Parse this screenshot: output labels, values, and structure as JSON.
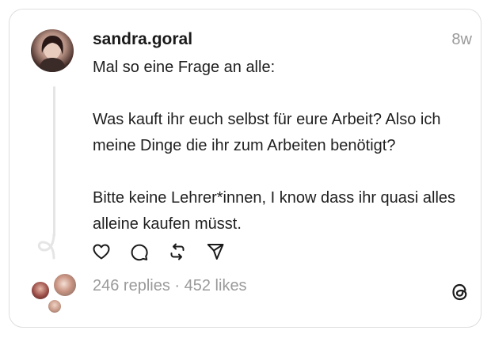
{
  "post": {
    "author": "sandra.goral",
    "timestamp": "8w",
    "paragraphs": [
      "Mal so eine Frage an alle:",
      "Was kauft ihr euch selbst für eure Arbeit? Also ich meine Dinge die ihr zum Arbeiten benötigt?",
      "Bitte keine Lehrer*innen, I know dass ihr quasi alles alleine kaufen müsst."
    ]
  },
  "stats": {
    "replies": "246 replies",
    "separator": " · ",
    "likes": "452 likes"
  },
  "actions": {
    "icons": [
      "heart-icon",
      "comment-icon",
      "repost-icon",
      "share-icon"
    ]
  },
  "brand": {
    "icon": "threads-logo-icon"
  },
  "colors": {
    "text": "#1f1f1f",
    "muted": "#9a9a9a",
    "border": "#dedede",
    "thread_line": "#e5e5e5"
  }
}
